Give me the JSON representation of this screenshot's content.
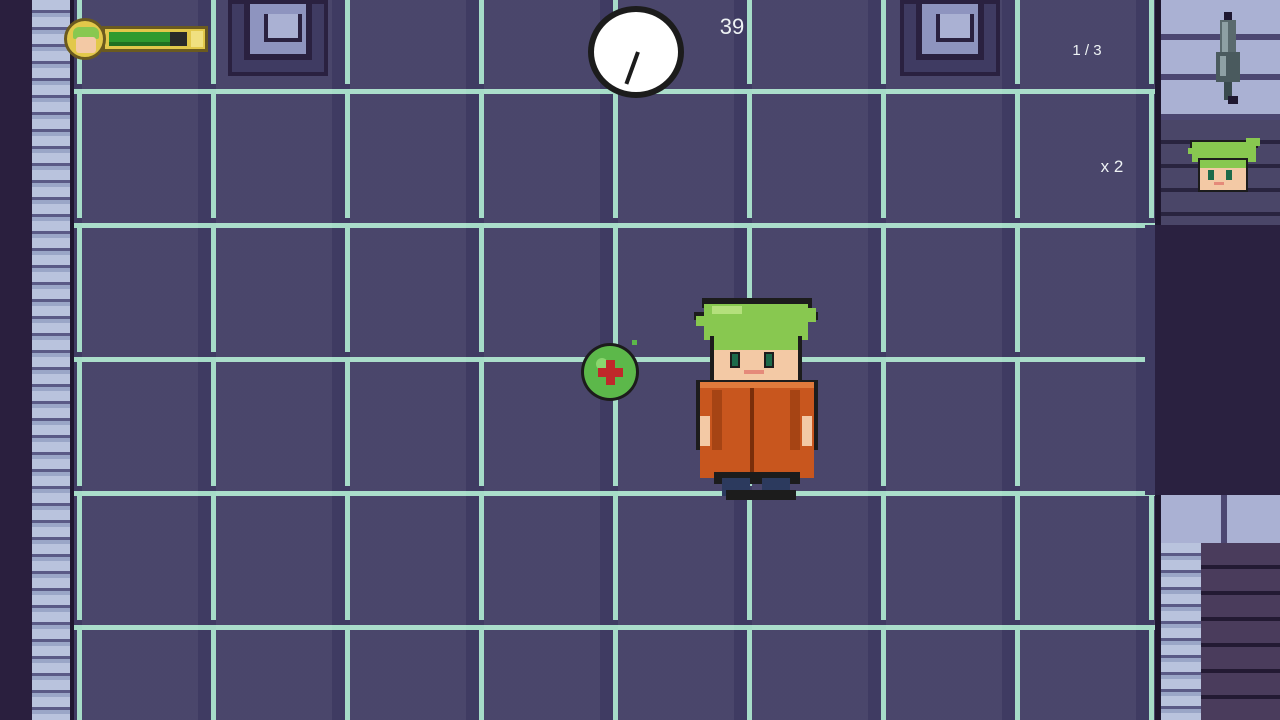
{
  "hud": {
    "health": {
      "fraction": 0.78,
      "bar_color": "#2f9a2f",
      "frame_color": "#e2c84a"
    },
    "timer": "39",
    "clock_icon": "clock-icon",
    "stage_progress": "1 / 3",
    "key_icon": "key-icon",
    "lives_count": "x 2",
    "lives_icon": "player-head-icon"
  },
  "scene": {
    "floor_color": "#aebfc0",
    "grid_line_color": "#3f3b62",
    "pickup": {
      "name": "health-pickup",
      "color": "#5cb84a",
      "cross_color": "#c0282a"
    },
    "player": {
      "hair_color": "#88c850",
      "coat_color": "#c8561e"
    }
  }
}
